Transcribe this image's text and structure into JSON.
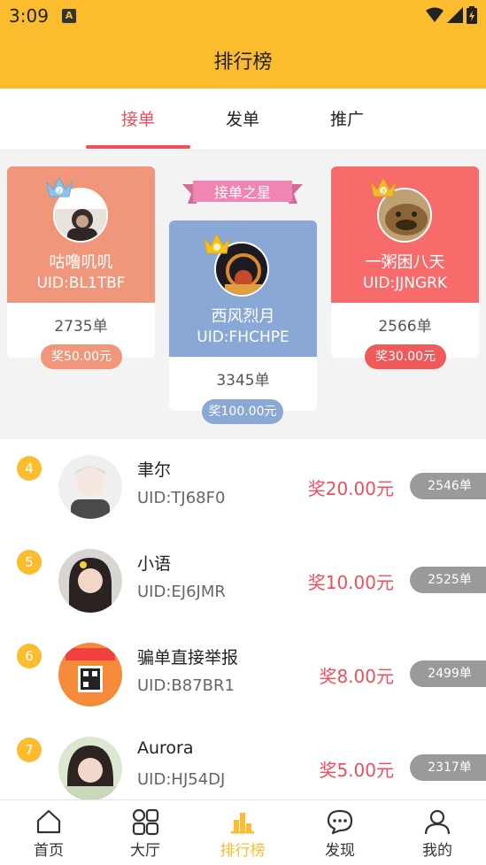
{
  "status": {
    "time": "3:09",
    "a_icon": "A"
  },
  "header": {
    "title": "排行榜"
  },
  "tabs": [
    {
      "label": "接单",
      "active": true
    },
    {
      "label": "发单",
      "active": false
    },
    {
      "label": "推广",
      "active": false
    }
  ],
  "podium": {
    "banner": "接单之星",
    "second": {
      "name": "咕噜叽叽",
      "uid": "UID:BL1TBF",
      "count": "2735单",
      "reward": "奖50.00元",
      "color": "#f0967a",
      "pill_color": "#f0967a"
    },
    "first": {
      "name": "西风烈月",
      "uid": "UID:FHCHPE",
      "count": "3345单",
      "reward": "奖100.00元",
      "color": "#8aa8d6",
      "pill_color": "#8aa8d6"
    },
    "third": {
      "name": "一粥困八天",
      "uid": "UID:JJNGRK",
      "count": "2566单",
      "reward": "奖30.00元",
      "color": "#f76b6b",
      "pill_color": "#f05a5a"
    }
  },
  "list": [
    {
      "rank": "4",
      "name": "聿尔",
      "uid": "UID:TJ68F0",
      "reward": "奖20.00元",
      "count": "2546单"
    },
    {
      "rank": "5",
      "name": "小语",
      "uid": "UID:EJ6JMR",
      "reward": "奖10.00元",
      "count": "2525单"
    },
    {
      "rank": "6",
      "name": "骗单直接举报",
      "uid": "UID:B87BR1",
      "reward": "奖8.00元",
      "count": "2499单"
    },
    {
      "rank": "7",
      "name": "Aurora",
      "uid": "UID:HJ54DJ",
      "reward": "奖5.00元",
      "count": "2317单"
    }
  ],
  "nav": [
    {
      "label": "首页",
      "icon": "home-icon"
    },
    {
      "label": "大厅",
      "icon": "grid-icon"
    },
    {
      "label": "排行榜",
      "icon": "ranking-icon",
      "active": true
    },
    {
      "label": "发现",
      "icon": "chat-icon"
    },
    {
      "label": "我的",
      "icon": "user-icon"
    }
  ],
  "colors": {
    "accent": "#fbbd2e",
    "red": "#f04e5b"
  }
}
